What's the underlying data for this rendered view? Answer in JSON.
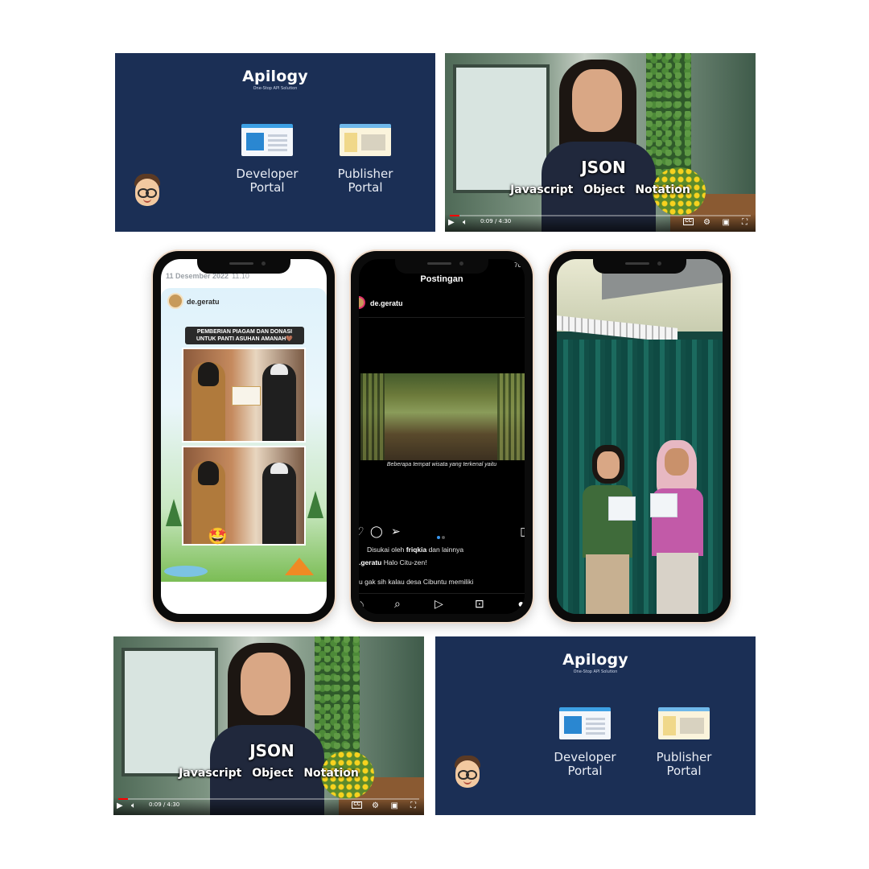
{
  "slides": [
    {
      "brand": "Apilogy",
      "tagline": "One-Stop API Solution",
      "developer_portal": "Developer\nPortal",
      "publisher_portal": "Publisher\nPortal"
    },
    {
      "brand": "Apilogy",
      "tagline": "One-Stop API Solution",
      "developer_portal": "Developer\nPortal",
      "publisher_portal": "Publisher\nPortal"
    }
  ],
  "videos": [
    {
      "title_overlay": "JSON",
      "subtitle_words": [
        "Javascript",
        "Object",
        "Notation"
      ],
      "time": "0:09 / 4:30",
      "progress": 0.033,
      "controls": [
        "play-icon",
        "volume-icon",
        "cc-icon",
        "settings-icon",
        "miniplayer-icon",
        "fullscreen-icon"
      ],
      "cc_label": "CC"
    },
    {
      "title_overlay": "JSON",
      "subtitle_words": [
        "Javascript",
        "Object",
        "Notation"
      ],
      "time": "0:09 / 4:30",
      "progress": 0.033,
      "controls": [
        "play-icon",
        "volume-icon",
        "cc-icon",
        "settings-icon",
        "miniplayer-icon",
        "fullscreen-icon"
      ],
      "cc_label": "CC"
    }
  ],
  "story": {
    "date": "11 Desember 2022",
    "hour": "11.10",
    "username": "de.geratu",
    "banner": "PEMBERIAN PIAGAM DAN DONASI UNTUK PANTI ASUHAN AMANAH🤎",
    "emoji": "🤩"
  },
  "instagram": {
    "status": "70",
    "header_user": "DE.GERATU",
    "header_title": "Postingan",
    "username": "de.geratu",
    "image_caption": "Beberapa tempat wisata yang terkenal yaitu",
    "liked_prefix": "Disukai oleh",
    "liked_user": "friqkia",
    "liked_suffix": "dan lainnya",
    "caption_user": ".geratu",
    "caption_text": "Halo Citu-zen!",
    "body_text": "u gak sih kalau desa Cibuntu memiliki",
    "nav_icons": [
      "home-icon",
      "search-icon",
      "reels-icon",
      "shop-icon",
      "profile-icon"
    ]
  },
  "colors": {
    "slide_bg": "#1b2f55",
    "progress_red": "#ff0000",
    "phone_frame": "#f0dccb",
    "insta_dot_active": "#3897f0"
  }
}
